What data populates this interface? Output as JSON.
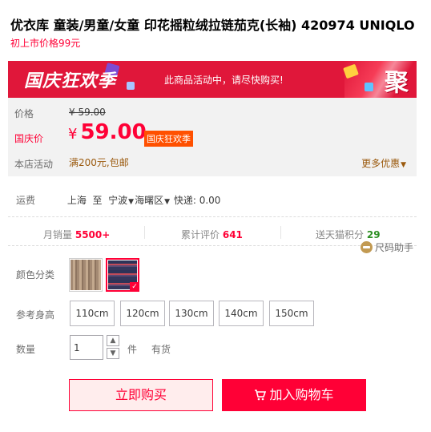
{
  "product": {
    "title": "优衣库 童装/男童/女童 印花摇粒绒拉链茄克(长袖) 420974 UNIQLO",
    "launch_price_note": "初上市价格99元"
  },
  "promo_banner": {
    "event_name": "国庆狂欢季",
    "hint": "此商品活动中，请尽快购买!",
    "ju_badge": "聚"
  },
  "price": {
    "original_label": "价格",
    "original_value": "¥ 59.00",
    "festival_label": "国庆价",
    "currency": "¥",
    "festival_value": "59.00",
    "festival_badge": "国庆狂欢季",
    "shop_promo_label": "本店活动",
    "shop_promo_value": "满200元,包邮",
    "more_deals": "更多优惠"
  },
  "shipping": {
    "label": "运费",
    "from": "上海",
    "to_word": "至",
    "city": "宁波",
    "district": "海曙区",
    "express": "快递: 0.00"
  },
  "stats": {
    "monthly_sales_label": "月销量",
    "monthly_sales_value": "5500+",
    "reviews_label": "累计评价",
    "reviews_value": "641",
    "points_label": "送天猫积分",
    "points_value": "29"
  },
  "size_helper": "尺码助手",
  "color": {
    "label": "颜色分类",
    "options": [
      "beige-stripe-jacket",
      "navy-pattern-jacket"
    ],
    "selected_index": 1
  },
  "height": {
    "label": "参考身高",
    "options": [
      "110cm",
      "120cm",
      "130cm",
      "140cm",
      "150cm"
    ]
  },
  "quantity": {
    "label": "数量",
    "value": "1",
    "unit": "件",
    "stock": "有货"
  },
  "actions": {
    "buy_now": "立即购买",
    "add_to_cart": "加入购物车"
  },
  "colors": {
    "accent": "#ff0036",
    "banner": "#e0173a",
    "badge": "#ff5000",
    "promo_text": "#9b5a0e"
  }
}
